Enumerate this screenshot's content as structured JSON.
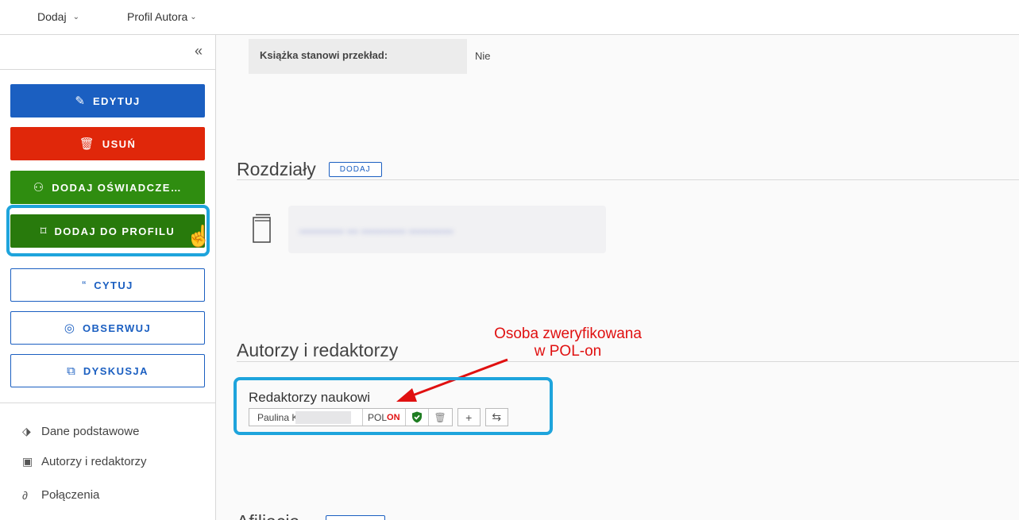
{
  "topbar": {
    "menu_add": "Dodaj",
    "menu_profile": "Profil Autora"
  },
  "sidebar": {
    "buttons": [
      {
        "label": "EDYTUJ",
        "icon": "pencil-icon"
      },
      {
        "label": "USUŃ",
        "icon": "trash-icon"
      },
      {
        "label": "DODAJ OŚWIADCZE…",
        "icon": "user-statement-icon"
      },
      {
        "label": "DODAJ DO PROFILU",
        "icon": "bookmark-icon"
      },
      {
        "label": "CYTUJ",
        "icon": "quote-icon"
      },
      {
        "label": "OBSERWUJ",
        "icon": "eye-icon"
      },
      {
        "label": "DYSKUSJA",
        "icon": "chat-icon"
      }
    ],
    "nav": [
      {
        "label": "Dane podstawowe",
        "icon": "tag-icon"
      },
      {
        "label": "Autorzy i redaktorzy",
        "icon": "badge-icon"
      },
      {
        "label": "Połączenia",
        "icon": "link-icon"
      }
    ]
  },
  "main": {
    "property": {
      "label": "Książka stanowi przekład:",
      "value": "Nie"
    },
    "chapters": {
      "title": "Rozdziały",
      "add_label": "DODAJ"
    },
    "authors": {
      "title": "Autorzy i redaktorzy",
      "annotation_line1": "Osoba zweryfikowana",
      "annotation_line2": "w POL-on",
      "editors_label": "Redaktorzy naukowi",
      "editor_name": "Paulina K",
      "polon_prefix": "POL",
      "polon_suffix": "ON"
    },
    "affiliations_partial": "Afiliacja"
  },
  "colors": {
    "primary": "#1b5fc1",
    "danger": "#e0270a",
    "success": "#2f8d10",
    "highlight": "#1ea4dc",
    "annotation": "#e01010"
  }
}
